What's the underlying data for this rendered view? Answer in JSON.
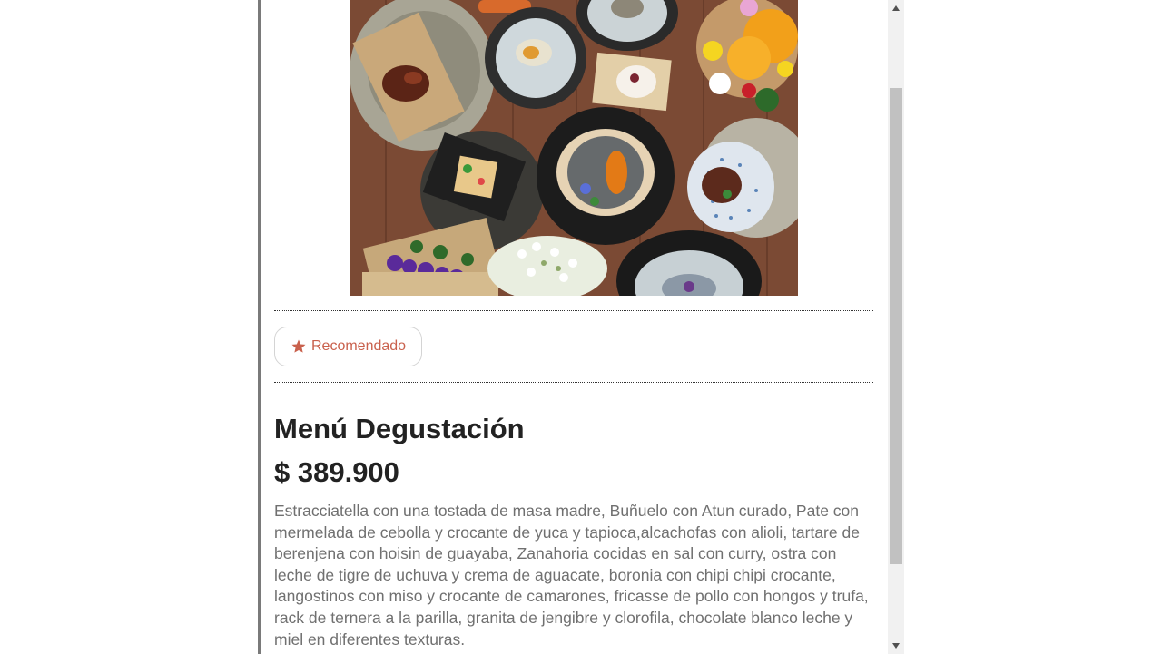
{
  "product": {
    "image_alt": "Tasting menu dishes arranged on a wooden table",
    "badge_label": "Recomendado",
    "badge_icon": "star-icon",
    "name": "Menú Degustación",
    "price": "$ 389.900",
    "description": "Estracciatella con una tostada de masa madre, Buñuelo con Atun curado, Pate con mermelada de cebolla y crocante de yuca y tapioca,alcachofas con alioli, tartare de berenjena con hoisin de guayaba, Zanahoria cocidas en sal con curry, ostra con leche de tigre de uchuva y crema de aguacate, boronia con chipi chipi crocante, langostinos con miso y crocante de camarones, fricasse de pollo con hongos y trufa, rack de ternera a la parilla, granita de jengibre y clorofila, chocolate blanco leche y miel en diferentes texturas."
  },
  "colors": {
    "accent": "#c9614d",
    "title": "#222222",
    "description": "#707070",
    "divider": "#333333"
  },
  "scrollbar": {
    "up_icon": "triangle-up-icon",
    "down_icon": "triangle-down-icon"
  }
}
